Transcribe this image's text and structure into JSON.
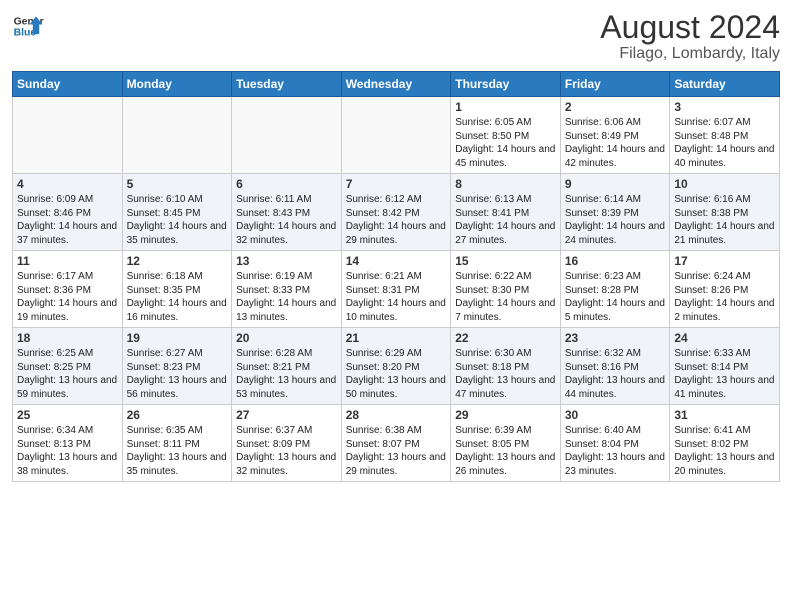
{
  "header": {
    "logo_line1": "General",
    "logo_line2": "Blue",
    "month": "August 2024",
    "location": "Filago, Lombardy, Italy"
  },
  "days_of_week": [
    "Sunday",
    "Monday",
    "Tuesday",
    "Wednesday",
    "Thursday",
    "Friday",
    "Saturday"
  ],
  "weeks": [
    [
      {
        "day": "",
        "info": ""
      },
      {
        "day": "",
        "info": ""
      },
      {
        "day": "",
        "info": ""
      },
      {
        "day": "",
        "info": ""
      },
      {
        "day": "1",
        "info": "Sunrise: 6:05 AM\nSunset: 8:50 PM\nDaylight: 14 hours and 45 minutes."
      },
      {
        "day": "2",
        "info": "Sunrise: 6:06 AM\nSunset: 8:49 PM\nDaylight: 14 hours and 42 minutes."
      },
      {
        "day": "3",
        "info": "Sunrise: 6:07 AM\nSunset: 8:48 PM\nDaylight: 14 hours and 40 minutes."
      }
    ],
    [
      {
        "day": "4",
        "info": "Sunrise: 6:09 AM\nSunset: 8:46 PM\nDaylight: 14 hours and 37 minutes."
      },
      {
        "day": "5",
        "info": "Sunrise: 6:10 AM\nSunset: 8:45 PM\nDaylight: 14 hours and 35 minutes."
      },
      {
        "day": "6",
        "info": "Sunrise: 6:11 AM\nSunset: 8:43 PM\nDaylight: 14 hours and 32 minutes."
      },
      {
        "day": "7",
        "info": "Sunrise: 6:12 AM\nSunset: 8:42 PM\nDaylight: 14 hours and 29 minutes."
      },
      {
        "day": "8",
        "info": "Sunrise: 6:13 AM\nSunset: 8:41 PM\nDaylight: 14 hours and 27 minutes."
      },
      {
        "day": "9",
        "info": "Sunrise: 6:14 AM\nSunset: 8:39 PM\nDaylight: 14 hours and 24 minutes."
      },
      {
        "day": "10",
        "info": "Sunrise: 6:16 AM\nSunset: 8:38 PM\nDaylight: 14 hours and 21 minutes."
      }
    ],
    [
      {
        "day": "11",
        "info": "Sunrise: 6:17 AM\nSunset: 8:36 PM\nDaylight: 14 hours and 19 minutes."
      },
      {
        "day": "12",
        "info": "Sunrise: 6:18 AM\nSunset: 8:35 PM\nDaylight: 14 hours and 16 minutes."
      },
      {
        "day": "13",
        "info": "Sunrise: 6:19 AM\nSunset: 8:33 PM\nDaylight: 14 hours and 13 minutes."
      },
      {
        "day": "14",
        "info": "Sunrise: 6:21 AM\nSunset: 8:31 PM\nDaylight: 14 hours and 10 minutes."
      },
      {
        "day": "15",
        "info": "Sunrise: 6:22 AM\nSunset: 8:30 PM\nDaylight: 14 hours and 7 minutes."
      },
      {
        "day": "16",
        "info": "Sunrise: 6:23 AM\nSunset: 8:28 PM\nDaylight: 14 hours and 5 minutes."
      },
      {
        "day": "17",
        "info": "Sunrise: 6:24 AM\nSunset: 8:26 PM\nDaylight: 14 hours and 2 minutes."
      }
    ],
    [
      {
        "day": "18",
        "info": "Sunrise: 6:25 AM\nSunset: 8:25 PM\nDaylight: 13 hours and 59 minutes."
      },
      {
        "day": "19",
        "info": "Sunrise: 6:27 AM\nSunset: 8:23 PM\nDaylight: 13 hours and 56 minutes."
      },
      {
        "day": "20",
        "info": "Sunrise: 6:28 AM\nSunset: 8:21 PM\nDaylight: 13 hours and 53 minutes."
      },
      {
        "day": "21",
        "info": "Sunrise: 6:29 AM\nSunset: 8:20 PM\nDaylight: 13 hours and 50 minutes."
      },
      {
        "day": "22",
        "info": "Sunrise: 6:30 AM\nSunset: 8:18 PM\nDaylight: 13 hours and 47 minutes."
      },
      {
        "day": "23",
        "info": "Sunrise: 6:32 AM\nSunset: 8:16 PM\nDaylight: 13 hours and 44 minutes."
      },
      {
        "day": "24",
        "info": "Sunrise: 6:33 AM\nSunset: 8:14 PM\nDaylight: 13 hours and 41 minutes."
      }
    ],
    [
      {
        "day": "25",
        "info": "Sunrise: 6:34 AM\nSunset: 8:13 PM\nDaylight: 13 hours and 38 minutes."
      },
      {
        "day": "26",
        "info": "Sunrise: 6:35 AM\nSunset: 8:11 PM\nDaylight: 13 hours and 35 minutes."
      },
      {
        "day": "27",
        "info": "Sunrise: 6:37 AM\nSunset: 8:09 PM\nDaylight: 13 hours and 32 minutes."
      },
      {
        "day": "28",
        "info": "Sunrise: 6:38 AM\nSunset: 8:07 PM\nDaylight: 13 hours and 29 minutes."
      },
      {
        "day": "29",
        "info": "Sunrise: 6:39 AM\nSunset: 8:05 PM\nDaylight: 13 hours and 26 minutes."
      },
      {
        "day": "30",
        "info": "Sunrise: 6:40 AM\nSunset: 8:04 PM\nDaylight: 13 hours and 23 minutes."
      },
      {
        "day": "31",
        "info": "Sunrise: 6:41 AM\nSunset: 8:02 PM\nDaylight: 13 hours and 20 minutes."
      }
    ]
  ],
  "alt_rows": [
    1,
    3
  ]
}
